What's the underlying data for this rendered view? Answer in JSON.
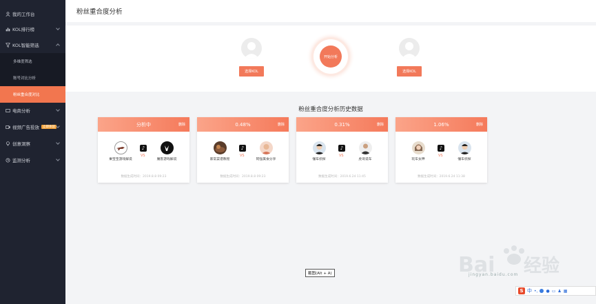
{
  "sidebar": {
    "items": [
      {
        "label": "我的工作台",
        "icon": "user-icon"
      },
      {
        "label": "KOL排行榜",
        "icon": "rank-icon"
      },
      {
        "label": "KOL智能筛选",
        "icon": "filter-icon"
      },
      {
        "label": "电商分析",
        "icon": "cart-icon"
      },
      {
        "label": "视频广告投放",
        "icon": "video-icon",
        "badge": "立即体验"
      },
      {
        "label": "创意洞察",
        "icon": "bulb-icon"
      },
      {
        "label": "监测分析",
        "icon": "monitor-icon"
      }
    ],
    "sub_items": [
      {
        "label": "多维度筛选"
      },
      {
        "label": "账号对比分析"
      },
      {
        "label": "粉丝重合度对比",
        "active": true
      }
    ]
  },
  "header": {
    "title": "粉丝重合度分析"
  },
  "compare": {
    "select_label_left": "选择KOL",
    "select_label_right": "选择KOL",
    "start_label": "开始分析"
  },
  "history": {
    "title": "粉丝重合度分析历史数据",
    "cards": [
      {
        "status": "分析中",
        "delete": "删除",
        "left": "果宝宝游戏解说",
        "right": "魔客游戏解说",
        "vs": "VS",
        "footer": "数据生成时间：2019.8.8 09:23"
      },
      {
        "status": "0.48%",
        "delete": "删除",
        "left": "家常菜谱教程",
        "right": "阿强美食分享",
        "vs": "VS",
        "footer": "数据生成时间：2019.8.8 09:23"
      },
      {
        "status": "0.31%",
        "delete": "删除",
        "left": "懂车侦探",
        "right": "虎哥说车",
        "vs": "VS",
        "footer": "数据生成时间：2019.6.24 11:45"
      },
      {
        "status": "1.06%",
        "delete": "删除",
        "left": "玩车女神",
        "right": "懂车侦探",
        "vs": "VS",
        "footer": "数据生成时间：2019.6.24 11:38"
      }
    ]
  },
  "overlay": {
    "tooltip": "截图(Alt + A)",
    "watermark_url": "jingyan.baidu.com",
    "tray_lang": "中"
  },
  "colors": {
    "accent": "#f2795a",
    "sidebar": "#1f2330",
    "active": "#f2764f"
  }
}
